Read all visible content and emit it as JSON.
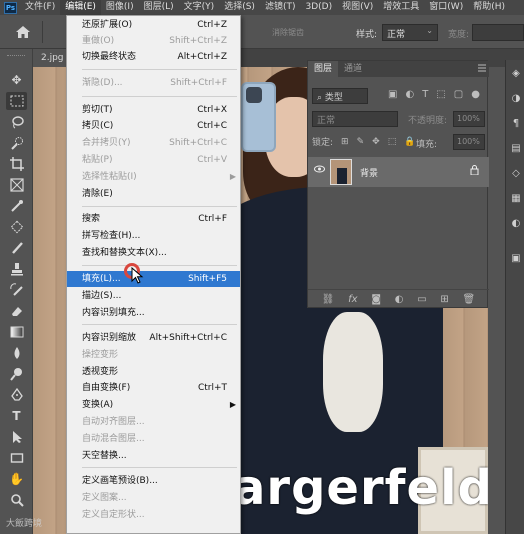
{
  "menubar": {
    "logo": "Ps",
    "items": [
      "文件(F)",
      "编辑(E)",
      "图像(I)",
      "图层(L)",
      "文字(Y)",
      "选择(S)",
      "滤镜(T)",
      "3D(D)",
      "视图(V)",
      "增效工具",
      "窗口(W)",
      "帮助(H)"
    ],
    "active_index": 1
  },
  "options_bar": {
    "faded_label": "消除锯齿",
    "style_label": "样式:",
    "style_value": "正常",
    "width_label": "宽度:"
  },
  "document_tab": {
    "name": "2.jpg"
  },
  "tools": [
    "move-tool",
    "marquee-tool",
    "lasso-tool",
    "quick-select-tool",
    "crop-tool",
    "frame-tool",
    "eyedropper-tool",
    "healing-brush-tool",
    "brush-tool",
    "clone-stamp-tool",
    "history-brush-tool",
    "eraser-tool",
    "gradient-tool",
    "blur-tool",
    "dodge-tool",
    "pen-tool",
    "type-tool",
    "path-select-tool",
    "rectangle-tool",
    "hand-tool",
    "zoom-tool"
  ],
  "selected_tool": "marquee-tool",
  "canvas": {
    "overlay_text": "argerfeld",
    "watermark": "大飯跨境"
  },
  "edit_menu": {
    "items": [
      {
        "label": "还原扩展(O)",
        "shortcut": "Ctrl+Z",
        "disabled": false
      },
      {
        "label": "重做(O)",
        "shortcut": "Shift+Ctrl+Z",
        "disabled": true
      },
      {
        "label": "切换最终状态",
        "shortcut": "Alt+Ctrl+Z",
        "disabled": false
      },
      {
        "label": "渐隐(D)...",
        "shortcut": "Shift+Ctrl+F",
        "disabled": true
      },
      {
        "label": "剪切(T)",
        "shortcut": "Ctrl+X",
        "disabled": false
      },
      {
        "label": "拷贝(C)",
        "shortcut": "Ctrl+C",
        "disabled": false
      },
      {
        "label": "合并拷贝(Y)",
        "shortcut": "Shift+Ctrl+C",
        "disabled": true
      },
      {
        "label": "粘贴(P)",
        "shortcut": "Ctrl+V",
        "disabled": true
      },
      {
        "label": "选择性粘贴(I)",
        "shortcut": "",
        "disabled": true,
        "submenu": true
      },
      {
        "label": "清除(E)",
        "shortcut": "",
        "disabled": false
      },
      {
        "label": "搜索",
        "shortcut": "Ctrl+F",
        "disabled": false
      },
      {
        "label": "拼写检查(H)...",
        "shortcut": "",
        "disabled": false
      },
      {
        "label": "查找和替换文本(X)...",
        "shortcut": "",
        "disabled": false
      },
      {
        "label": "填充(L)...",
        "shortcut": "Shift+F5",
        "disabled": false,
        "highlighted": true
      },
      {
        "label": "描边(S)...",
        "shortcut": "",
        "disabled": false
      },
      {
        "label": "内容识别填充...",
        "shortcut": "",
        "disabled": false
      },
      {
        "label": "内容识别缩放",
        "shortcut": "Alt+Shift+Ctrl+C",
        "disabled": false
      },
      {
        "label": "操控变形",
        "shortcut": "",
        "disabled": true
      },
      {
        "label": "透视变形",
        "shortcut": "",
        "disabled": false
      },
      {
        "label": "自由变换(F)",
        "shortcut": "Ctrl+T",
        "disabled": false
      },
      {
        "label": "变换(A)",
        "shortcut": "",
        "disabled": false,
        "submenu": true
      },
      {
        "label": "自动对齐图层...",
        "shortcut": "",
        "disabled": true
      },
      {
        "label": "自动混合图层...",
        "shortcut": "",
        "disabled": true
      },
      {
        "label": "天空替换...",
        "shortcut": "",
        "disabled": false
      },
      {
        "label": "定义画笔预设(B)...",
        "shortcut": "",
        "disabled": false
      },
      {
        "label": "定义图案...",
        "shortcut": "",
        "disabled": true
      },
      {
        "label": "定义自定形状...",
        "shortcut": "",
        "disabled": true
      }
    ]
  },
  "layers_panel": {
    "tabs": [
      "图层",
      "通道"
    ],
    "active_tab": "图层",
    "filter_placeholder": "类型",
    "blend_mode": "正常",
    "opacity_label": "不透明度:",
    "opacity_value": "100%",
    "lock_label": "锁定:",
    "fill_label": "填充:",
    "fill_value": "100%",
    "layers": [
      {
        "name": "背景",
        "visible": true,
        "locked": true
      }
    ]
  },
  "colors": {
    "highlight": "#2f78d0",
    "panel_bg": "#535353",
    "menu_bg": "#f0f0f0",
    "click_ring": "#d9473e"
  }
}
